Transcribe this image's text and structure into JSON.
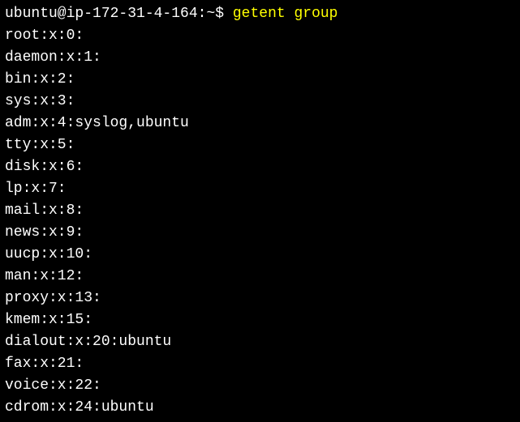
{
  "prompt": "ubuntu@ip-172-31-4-164:~$ ",
  "command": "getent group",
  "output": [
    "root:x:0:",
    "daemon:x:1:",
    "bin:x:2:",
    "sys:x:3:",
    "adm:x:4:syslog,ubuntu",
    "tty:x:5:",
    "disk:x:6:",
    "lp:x:7:",
    "mail:x:8:",
    "news:x:9:",
    "uucp:x:10:",
    "man:x:12:",
    "proxy:x:13:",
    "kmem:x:15:",
    "dialout:x:20:ubuntu",
    "fax:x:21:",
    "voice:x:22:",
    "cdrom:x:24:ubuntu"
  ]
}
